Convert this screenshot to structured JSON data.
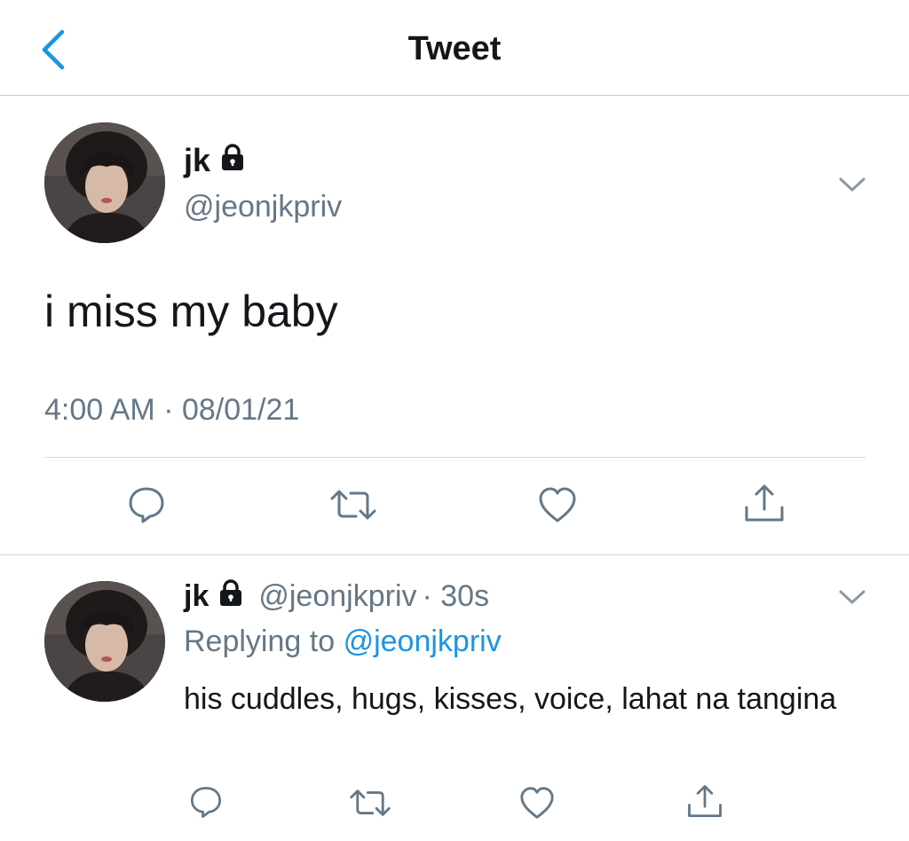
{
  "header": {
    "title": "Tweet",
    "back_icon": "chevron-left-icon"
  },
  "colors": {
    "accent": "#1b95e0",
    "secondary_text": "#657786",
    "primary_text": "#14171a",
    "divider": "#d4d9dd"
  },
  "main_tweet": {
    "name": "jk",
    "handle": "@jeonjkpriv",
    "text": "i miss my baby",
    "timestamp": "4:00 AM · 08/01/21",
    "icons": [
      "lock-icon",
      "chevron-down-icon",
      "reply-icon",
      "retweet-icon",
      "like-icon",
      "share-icon"
    ]
  },
  "reply": {
    "name": "jk",
    "handle": "@jeonjkpriv",
    "time": "· 30s",
    "replying_label": "Replying to",
    "replying_handle": "@jeonjkpriv",
    "text": "his cuddles, hugs, kisses, voice, lahat na tangina"
  }
}
